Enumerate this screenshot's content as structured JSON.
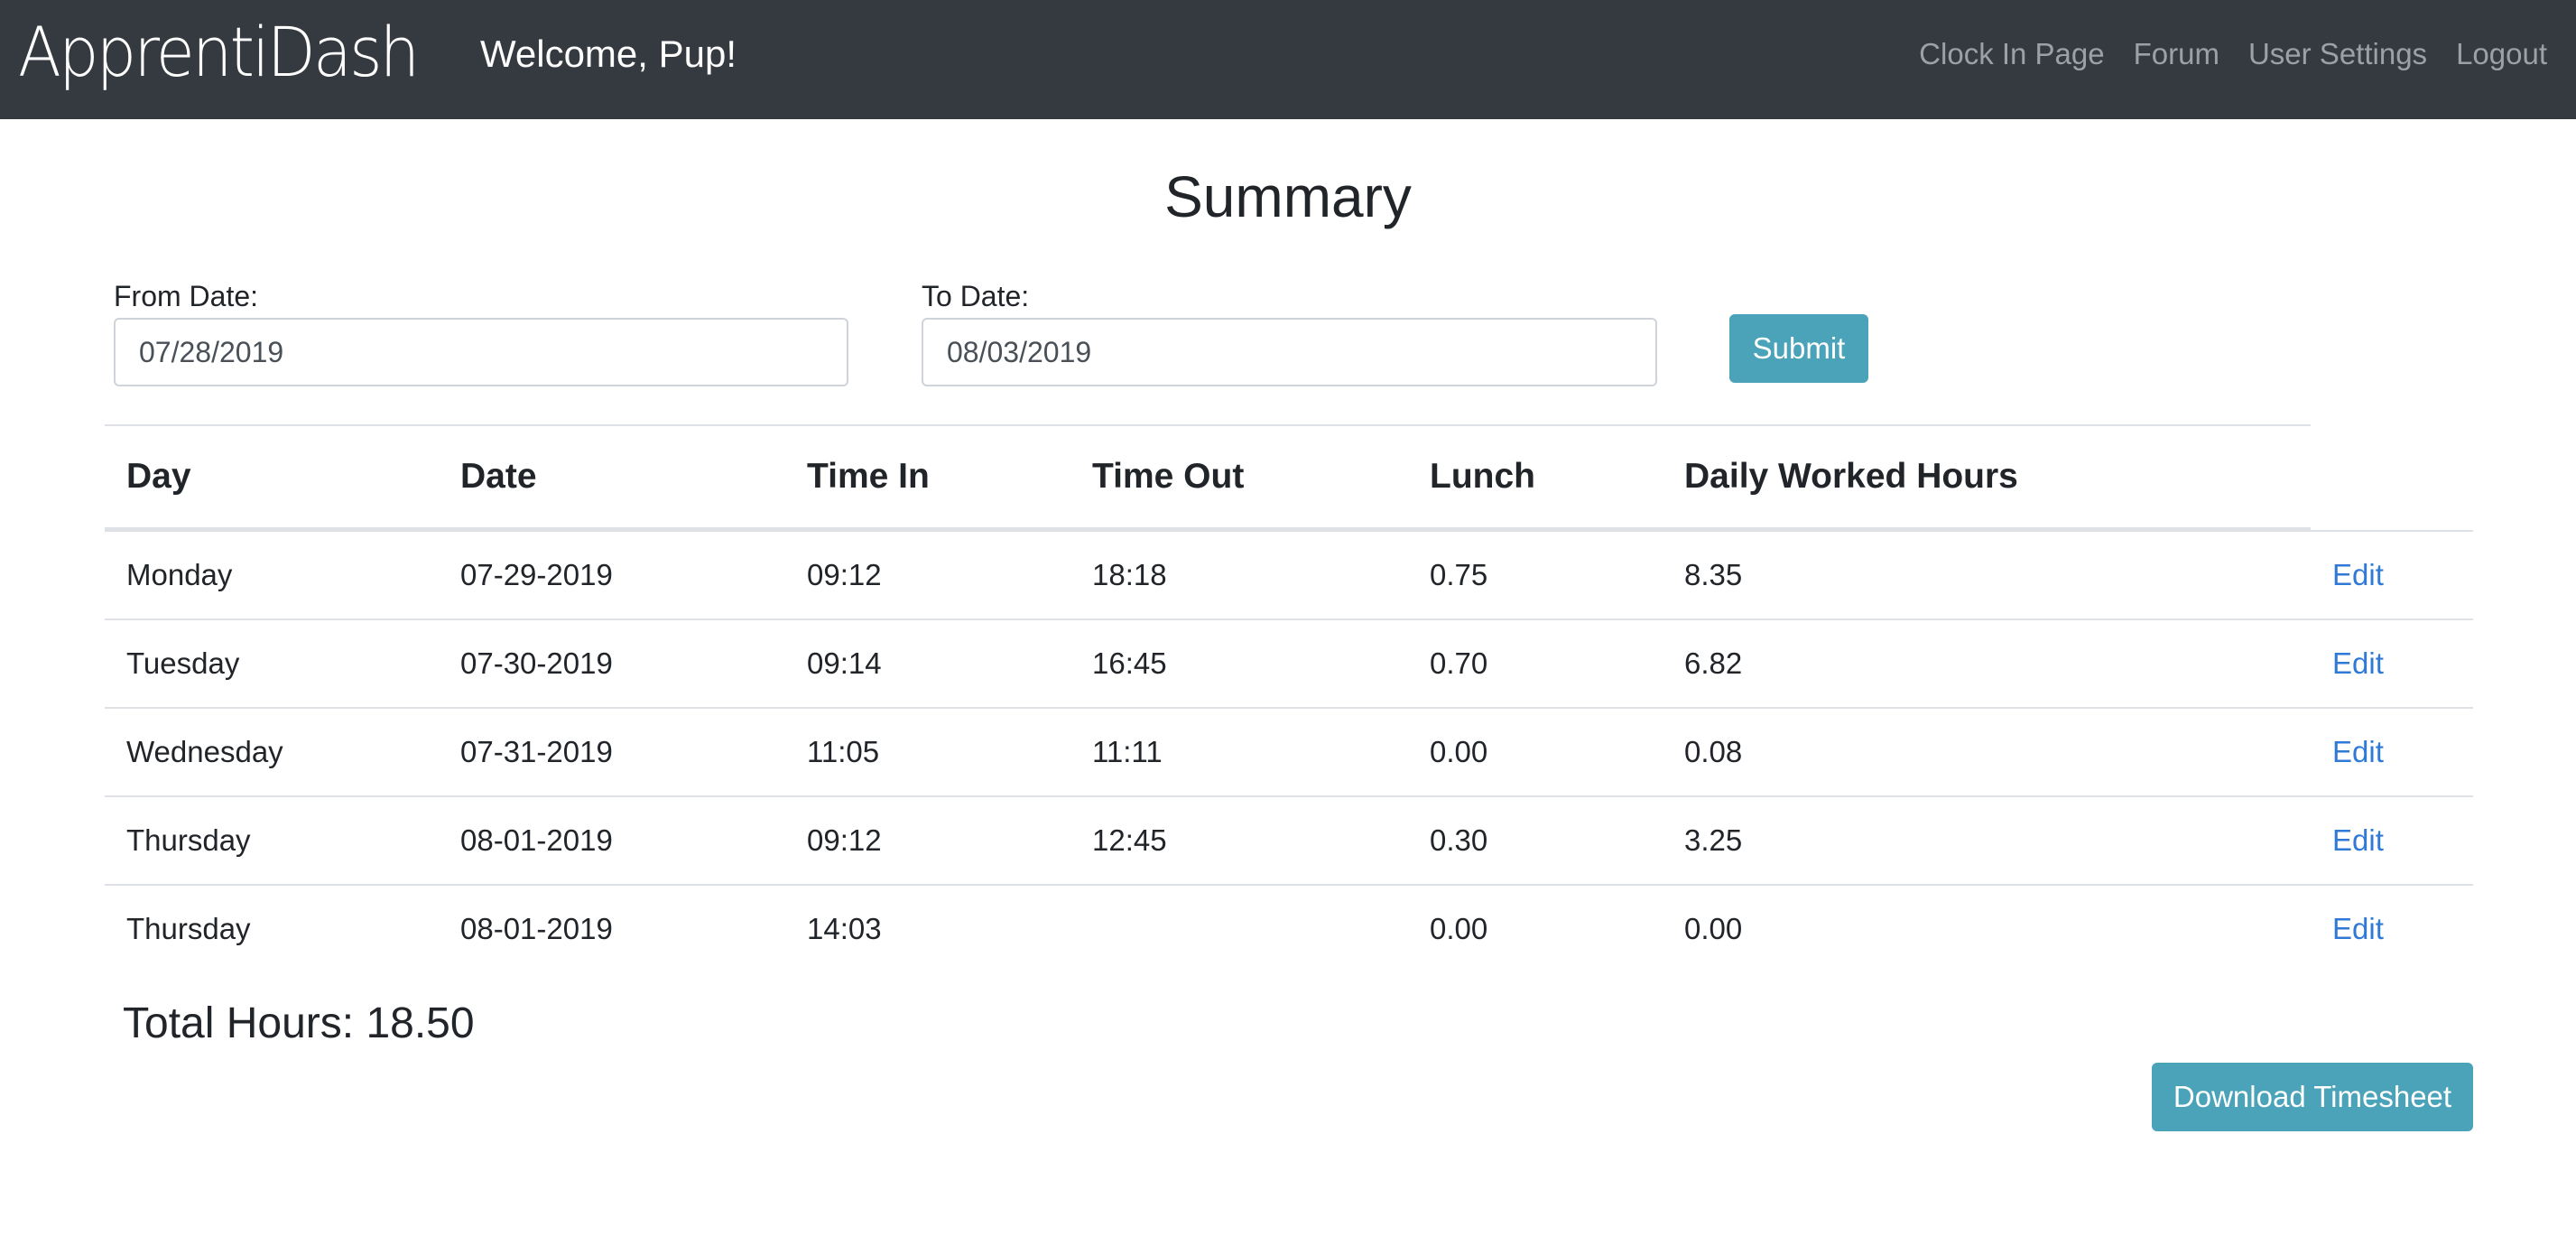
{
  "navbar": {
    "brand": "ApprentiDash",
    "welcome": "Welcome, Pup!",
    "links": [
      "Clock In Page",
      "Forum",
      "User Settings",
      "Logout"
    ]
  },
  "page": {
    "title": "Summary"
  },
  "filters": {
    "from_label": "From Date:",
    "from_value": "07/28/2019",
    "to_label": "To Date:",
    "to_value": "08/03/2019",
    "submit_label": "Submit"
  },
  "table": {
    "headers": [
      "Day",
      "Date",
      "Time In",
      "Time Out",
      "Lunch",
      "Daily Worked Hours"
    ],
    "rows": [
      {
        "day": "Monday",
        "date": "07-29-2019",
        "time_in": "09:12",
        "time_out": "18:18",
        "lunch": "0.75",
        "hours": "8.35",
        "action": "Edit"
      },
      {
        "day": "Tuesday",
        "date": "07-30-2019",
        "time_in": "09:14",
        "time_out": "16:45",
        "lunch": "0.70",
        "hours": "6.82",
        "action": "Edit"
      },
      {
        "day": "Wednesday",
        "date": "07-31-2019",
        "time_in": "11:05",
        "time_out": "11:11",
        "lunch": "0.00",
        "hours": "0.08",
        "action": "Edit"
      },
      {
        "day": "Thursday",
        "date": "08-01-2019",
        "time_in": "09:12",
        "time_out": "12:45",
        "lunch": "0.30",
        "hours": "3.25",
        "action": "Edit"
      },
      {
        "day": "Thursday",
        "date": "08-01-2019",
        "time_in": "14:03",
        "time_out": "",
        "lunch": "0.00",
        "hours": "0.00",
        "action": "Edit"
      }
    ]
  },
  "summary": {
    "total_label": "Total Hours: 18.50",
    "download_label": "Download Timesheet"
  },
  "colors": {
    "navbar": "#343a40",
    "info_button": "#4aa3b8",
    "link": "#2f7ad6"
  }
}
